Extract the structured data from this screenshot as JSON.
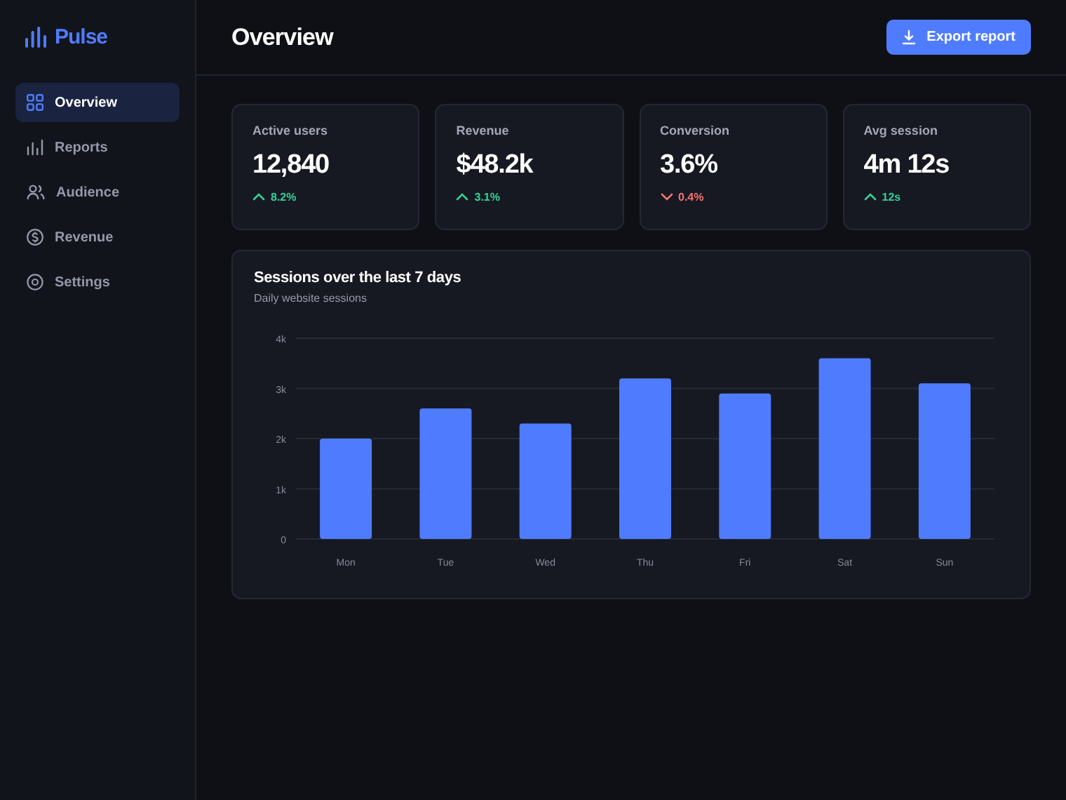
{
  "brand": {
    "name": "Pulse"
  },
  "sidebar": {
    "items": [
      {
        "label": "Overview",
        "selected": true
      },
      {
        "label": "Reports",
        "selected": false
      },
      {
        "label": "Audience",
        "selected": false
      },
      {
        "label": "Revenue",
        "selected": false
      },
      {
        "label": "Settings",
        "selected": false
      }
    ]
  },
  "header": {
    "title": "Overview",
    "button": "Export report"
  },
  "stats": [
    {
      "label": "Active users",
      "value": "12,840",
      "change": "8.2%",
      "rising": true
    },
    {
      "label": "Revenue",
      "value": "$48.2k",
      "change": "3.1%",
      "rising": true
    },
    {
      "label": "Conversion",
      "value": "3.6%",
      "change": "0.4%",
      "rising": false
    },
    {
      "label": "Avg session",
      "value": "4m 12s",
      "change": "12s",
      "rising": true
    }
  ],
  "chart": {
    "title": "Sessions over the last 7 days",
    "subtitle": "Daily website sessions",
    "chart_data": {
      "type": "bar",
      "categories": [
        "Mon",
        "Tue",
        "Wed",
        "Thu",
        "Fri",
        "Sat",
        "Sun"
      ],
      "grid": true,
      "series": [
        {
          "color": "#4f7cff",
          "values": [
            2000,
            2600,
            2300,
            3200,
            2900,
            3600,
            3100
          ]
        }
      ],
      "ylim": [
        0,
        4000
      ],
      "yticks": [
        {
          "value": 0,
          "label": "0"
        },
        {
          "value": 1000,
          "label": "1k"
        },
        {
          "value": 2000,
          "label": "2k"
        },
        {
          "value": 3000,
          "label": "3k"
        },
        {
          "value": 4000,
          "label": "4k"
        }
      ]
    }
  }
}
